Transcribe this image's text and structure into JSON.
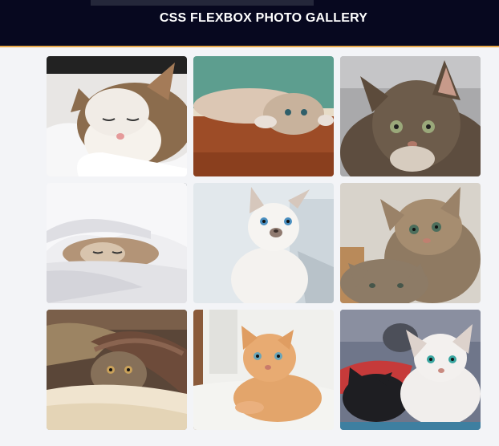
{
  "header": {
    "title": "CSS FLEXBOX PHOTO GALLERY"
  },
  "gallery": {
    "photos": [
      {
        "name": "photo-sleeping-cat-bedsheet",
        "bg": "#d9d6d4",
        "accent": "#8a6a4a",
        "fur": "#f2efea"
      },
      {
        "name": "photo-kitten-lying-on-floor",
        "bg": "#5a9c8c",
        "accent": "#9a4a28",
        "fur": "#d8c4b2"
      },
      {
        "name": "photo-tabby-cat-portrait",
        "bg": "#a8a8a8",
        "accent": "#5b4a3b",
        "fur": "#6d5d4e"
      },
      {
        "name": "photo-kitten-under-blanket",
        "bg": "#f0f0f2",
        "accent": "#c9c9cf",
        "fur": "#b99a7a"
      },
      {
        "name": "photo-white-kitten-blue-eyes",
        "bg": "#dfe6ea",
        "accent": "#cfd6da",
        "fur": "#f3f1ee"
      },
      {
        "name": "photo-tabby-kittens-pair",
        "bg": "#d6d0c8",
        "accent": "#8a7a66",
        "fur": "#a58d70"
      },
      {
        "name": "photo-cat-under-brown-blanket",
        "bg": "#6a5544",
        "accent": "#a87c5c",
        "fur": "#85705a"
      },
      {
        "name": "photo-orange-kitten-lying",
        "bg": "#efefec",
        "accent": "#dcdcd6",
        "fur": "#e5a56a"
      },
      {
        "name": "photo-kittens-black-white",
        "bg": "#6e7486",
        "accent": "#c83b3b",
        "fur": "#f1efee"
      }
    ]
  }
}
